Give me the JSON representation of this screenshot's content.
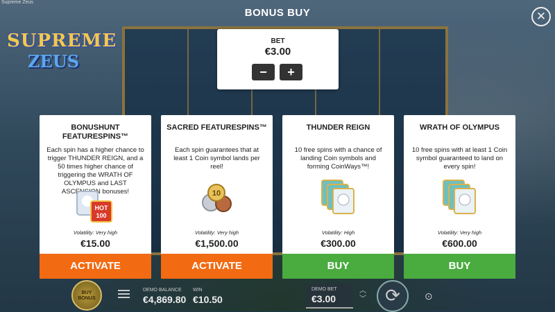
{
  "window_title": "Supreme Zeus",
  "logo": {
    "line1": "SUPREME",
    "line2": "ZEUS"
  },
  "modal": {
    "title": "BONUS BUY",
    "close_icon": "close-icon"
  },
  "bet": {
    "label": "BET",
    "value": "€3.00",
    "minus": "−",
    "plus": "+"
  },
  "cards": [
    {
      "name": "BONUSHUNT FEATURESPINS™",
      "description": "Each spin has a higher chance to trigger THUNDER REIGN, and a 50 times higher chance of triggering the WRATH OF OLYMPUS and LAST ASCENSION bonuses!",
      "volatility": "Volatility: Very high",
      "price": "€15.00",
      "button": "ACTIVATE",
      "button_color": "#f26a12",
      "art_icon": "zeus-hot-coin-icon"
    },
    {
      "name": "SACRED FEATURESPINS™",
      "description": "Each spin guarantees that at least 1 Coin symbol lands per reel!",
      "volatility": "Volatility: Very high",
      "price": "€1,500.00",
      "button": "ACTIVATE",
      "button_color": "#f26a12",
      "art_icon": "coins-icon"
    },
    {
      "name": "THUNDER REIGN",
      "description": "10 free spins with a chance of landing Coin symbols and forming CoinWays™!",
      "volatility": "Volatility: High",
      "price": "€300.00",
      "button": "BUY",
      "button_color": "#4aab3f",
      "art_icon": "zeus-cards-icon"
    },
    {
      "name": "WRATH OF OLYMPUS",
      "description": "10 free spins with at least 1 Coin symbol guaranteed to land on every spin!",
      "volatility": "Volatility: Very high",
      "price": "€600.00",
      "button": "BUY",
      "button_color": "#4aab3f",
      "art_icon": "zeus-cards-icon"
    }
  ],
  "bottom": {
    "buy_bonus": "BUY BONUS",
    "demo_balance_label": "DEMO BALANCE",
    "demo_balance": "€4,869.80",
    "win_label": "WIN",
    "win": "€10.50",
    "demo_bet_label": "DEMO BET",
    "demo_bet": "€3.00"
  }
}
